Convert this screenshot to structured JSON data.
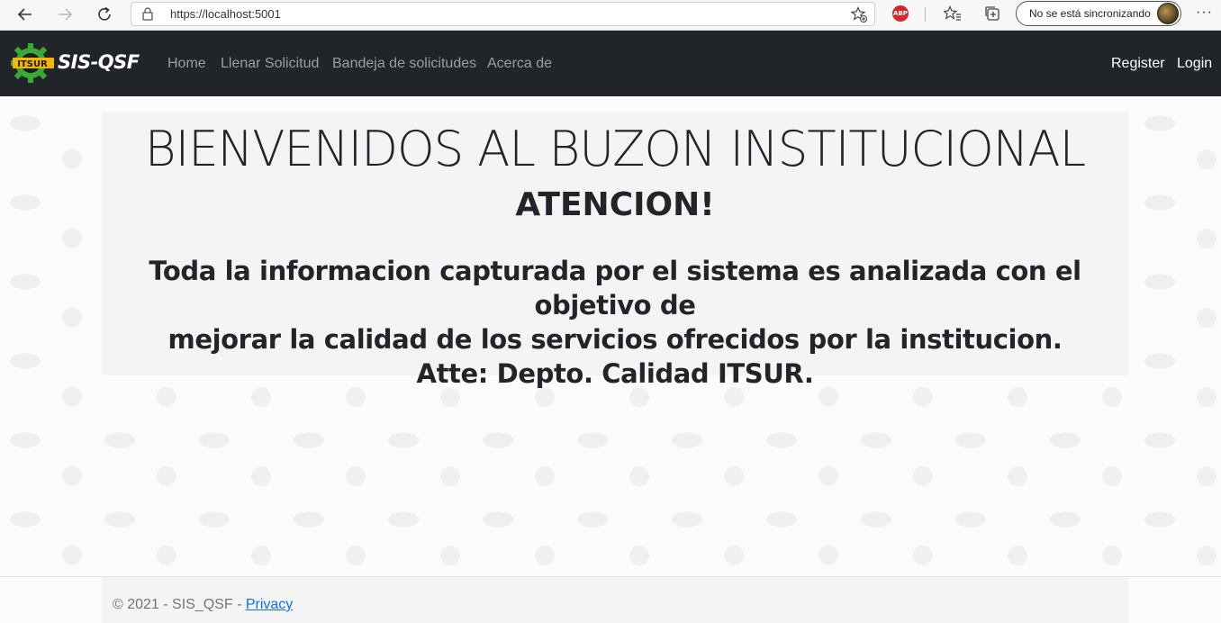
{
  "browser": {
    "url": "https://localhost:5001",
    "sync_label": "No se está sincronizando",
    "more_label": "···",
    "abp_label": "ABP"
  },
  "navbar": {
    "brand": "SIS-QSF",
    "logo_text": "ITSUR",
    "links": [
      "Home",
      "Llenar Solicitud",
      "Bandeja de solicitudes",
      "Acerca de"
    ],
    "right_links": [
      "Register",
      "Login"
    ]
  },
  "main": {
    "title": "BIENVENIDOS AL BUZON INSTITUCIONAL",
    "attention": "ATENCION!",
    "message_line1": "Toda la informacion capturada por el sistema es analizada con el objetivo de",
    "message_line2": "mejorar la calidad de los servicios ofrecidos por la institucion.",
    "message_line3": "Atte: Depto. Calidad ITSUR."
  },
  "footer": {
    "text": "© 2021 - SIS_QSF - ",
    "privacy": "Privacy"
  }
}
